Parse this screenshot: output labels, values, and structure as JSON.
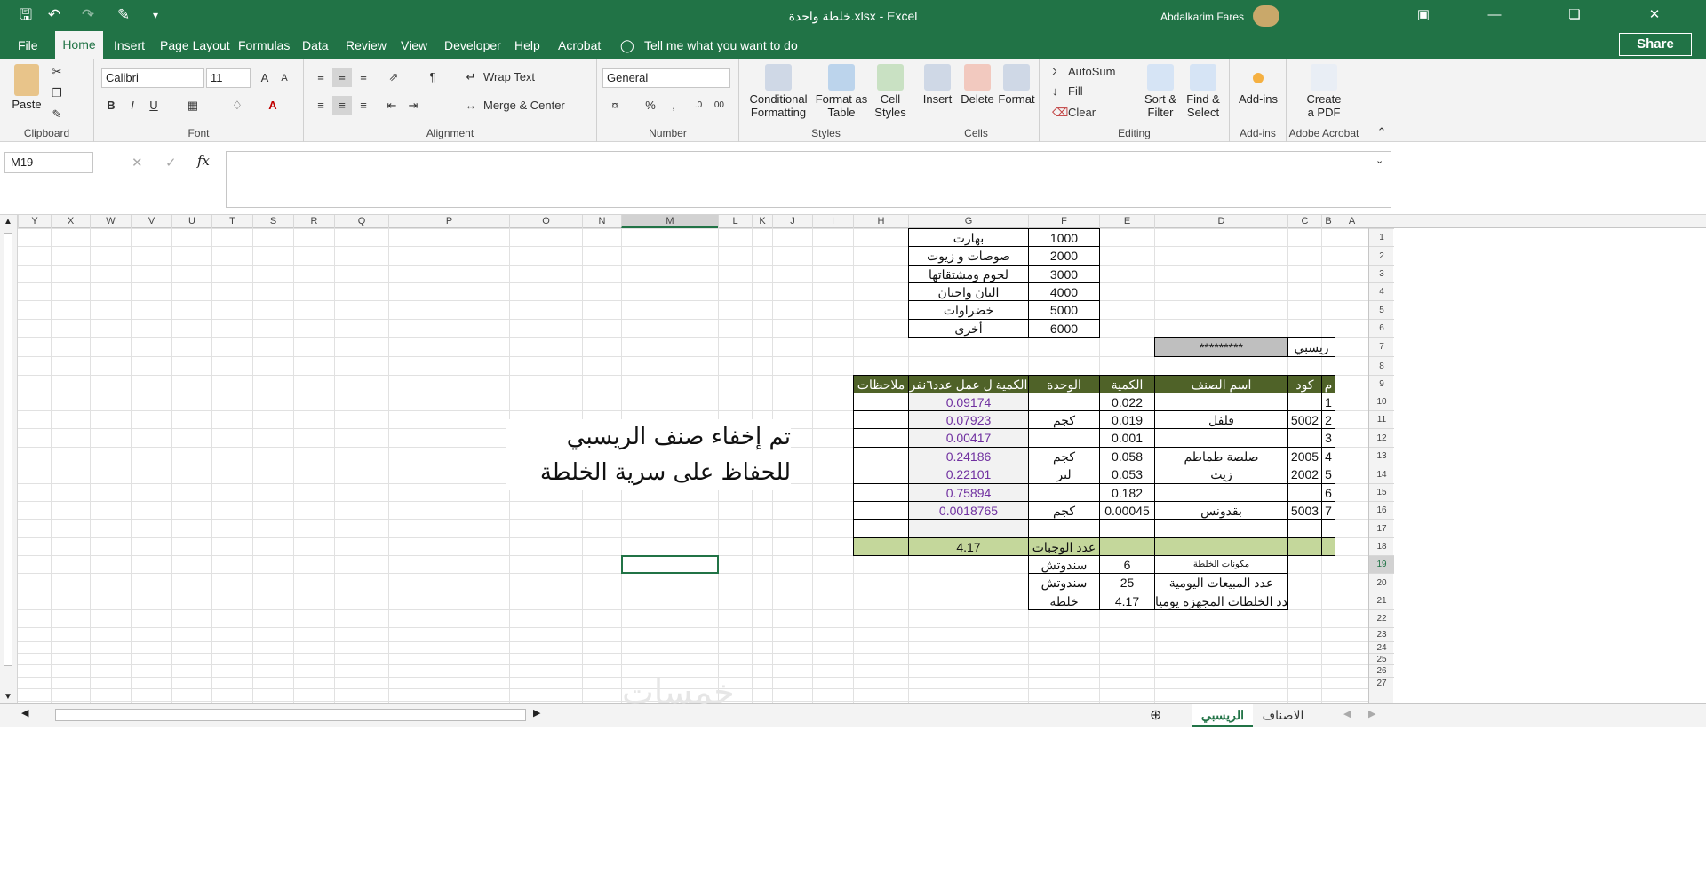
{
  "window": {
    "title": "خلطة واحدة.xlsx  -  Excel",
    "user": "Abdalkarim Fares"
  },
  "menu": {
    "file": "File",
    "home": "Home",
    "insert": "Insert",
    "page_layout": "Page Layout",
    "formulas": "Formulas",
    "data": "Data",
    "review": "Review",
    "view": "View",
    "developer": "Developer",
    "help": "Help",
    "acrobat": "Acrobat",
    "tell_me": "Tell me what you want to do",
    "share": "Share"
  },
  "ribbon": {
    "paste": "Paste",
    "clipboard": "Clipboard",
    "font_name": "Calibri",
    "font_size": "11",
    "font": "Font",
    "wrap_text": "Wrap Text",
    "merge_center": "Merge & Center",
    "alignment": "Alignment",
    "number_format": "General",
    "number": "Number",
    "conditional": "Conditional",
    "formatting": "Formatting",
    "format_as": "Format as",
    "table": "Table",
    "cell": "Cell",
    "styles_btn": "Styles",
    "styles": "Styles",
    "insert": "Insert",
    "delete": "Delete",
    "format": "Format",
    "cells": "Cells",
    "autosum": "AutoSum",
    "fill": "Fill",
    "clear": "Clear",
    "sort": "Sort &",
    "filter": "Filter",
    "find": "Find &",
    "select": "Select",
    "editing": "Editing",
    "addins_btn": "Add-ins",
    "addins": "Add-ins",
    "create": "Create",
    "a_pdf": "a PDF",
    "adobe": "Adobe Acrobat"
  },
  "formula_bar": {
    "name_box": "M19",
    "formula": ""
  },
  "columns": [
    "Y",
    "X",
    "W",
    "V",
    "U",
    "T",
    "S",
    "R",
    "Q",
    "P",
    "O",
    "N",
    "M",
    "L",
    "K",
    "J",
    "I",
    "H",
    "G",
    "F",
    "E",
    "D",
    "C",
    "B",
    "A"
  ],
  "rows": [
    "1",
    "2",
    "3",
    "4",
    "5",
    "6",
    "7",
    "8",
    "9",
    "10",
    "11",
    "12",
    "13",
    "14",
    "15",
    "16",
    "17",
    "18",
    "19",
    "20",
    "21",
    "22",
    "23",
    "24",
    "25",
    "26",
    "27"
  ],
  "categories": [
    {
      "name": "بهارت",
      "code": "1000"
    },
    {
      "name": "صوصات و زيوت",
      "code": "2000"
    },
    {
      "name": "لحوم ومشتقاتها",
      "code": "3000"
    },
    {
      "name": "البان واجبان",
      "code": "4000"
    },
    {
      "name": "خضراوات",
      "code": "5000"
    },
    {
      "name": "أخرى",
      "code": "6000"
    }
  ],
  "main_label": "ريسبي",
  "main_value": "*********",
  "table": {
    "headers": {
      "m": "م",
      "code": "كود",
      "name": "اسم الصنف",
      "qty": "الكمية",
      "unit": "الوحدة",
      "qty_per": "الكمية ل عمل عدد٦نفر",
      "notes": "ملاحظات"
    },
    "rows": [
      {
        "m": "1",
        "code": "",
        "name": "",
        "qty": "0.022",
        "unit": "",
        "qty_per": "0.09174"
      },
      {
        "m": "2",
        "code": "5002",
        "name": "فلفل",
        "qty": "0.019",
        "unit": "كجم",
        "qty_per": "0.07923"
      },
      {
        "m": "3",
        "code": "",
        "name": "",
        "qty": "0.001",
        "unit": "",
        "qty_per": "0.00417"
      },
      {
        "m": "4",
        "code": "2005",
        "name": "صلصة طماطم",
        "qty": "0.058",
        "unit": "كجم",
        "qty_per": "0.24186"
      },
      {
        "m": "5",
        "code": "2002",
        "name": "زيت",
        "qty": "0.053",
        "unit": "لتر",
        "qty_per": "0.22101"
      },
      {
        "m": "6",
        "code": "",
        "name": "",
        "qty": "0.182",
        "unit": "",
        "qty_per": "0.75894"
      },
      {
        "m": "7",
        "code": "5003",
        "name": "بقدونس",
        "qty": "0.00045",
        "unit": "كجم",
        "qty_per": "0.0018765"
      }
    ],
    "meals_label": "عدد الوجبات",
    "meals_value": "4.17"
  },
  "summary": [
    {
      "label": "مكونات الخلطة",
      "value": "6",
      "unit": "سندوتش"
    },
    {
      "label": "عدد المبيعات اليومية",
      "value": "25",
      "unit": "سندوتش"
    },
    {
      "label": "عدد الخلطات المجهزة يوميا",
      "value": "4.17",
      "unit": "خلطة"
    }
  ],
  "note": {
    "line1": "تم إخفاء صنف الريسبي",
    "line2": "للحفاظ على سرية الخلطة"
  },
  "sheets": {
    "active": "الريسبي",
    "other": "الاصناف"
  },
  "watermark": "خمسات",
  "colors": {
    "excel_green": "#217346",
    "header_green": "#4f6228",
    "light_green": "#c4d79b",
    "purple": "#7030a0"
  }
}
